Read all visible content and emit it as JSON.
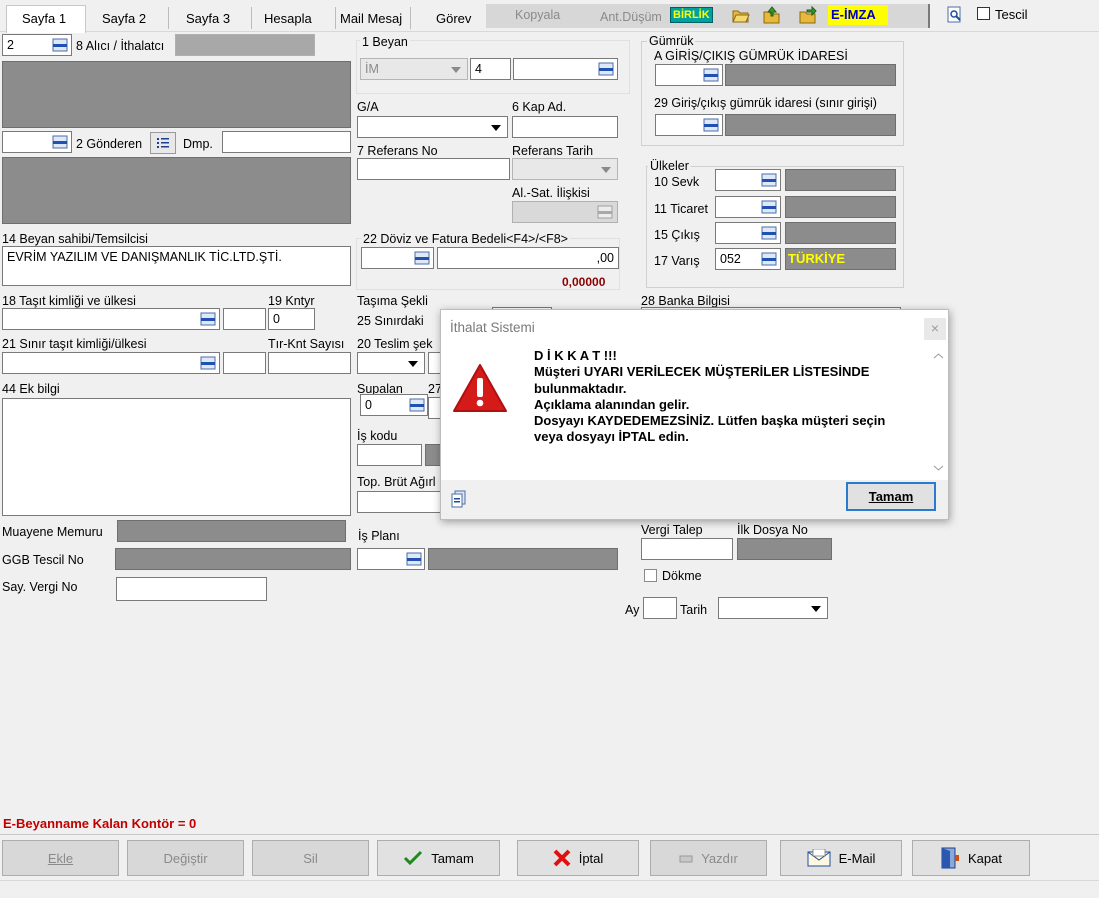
{
  "tabs": [
    "Sayfa 1",
    "Sayfa 2",
    "Sayfa 3",
    "Hesapla",
    "Mail Mesaj",
    "Görev"
  ],
  "toolbar": {
    "kopyala": "Kopyala",
    "ant_dusum": "Ant.Düşüm",
    "birlik": "BİRLİK",
    "eimza": "E-İMZA",
    "tescil": "Tescil"
  },
  "left": {
    "alici_value": "2",
    "alici_label": "8 Alıcı / İthalatcı",
    "gonderen_label": "2 Gönderen",
    "dmp_label": "Dmp.",
    "beyan_sahibi_label": "14 Beyan sahibi/Temsilcisi",
    "beyan_sahibi_value": "EVRİM YAZILIM VE DANIŞMANLIK TİC.LTD.ŞTİ.",
    "tasit_label": "18 Taşıt kimliği ve ülkesi",
    "kntyr_label": "19 Kntyr",
    "kntyr_value": "0",
    "sinir_tasit_label": "21 Sınır taşıt kimliği/ülkesi",
    "tir_label": "Tır-Knt Sayısı",
    "ek_bilgi_label": "44 Ek bilgi",
    "muayene_label": "Muayene Memuru",
    "ggb_label": "GGB Tescil No",
    "say_vergi_label": "Say. Vergi No"
  },
  "middle": {
    "beyan_label": "1 Beyan",
    "beyan_type": "İM",
    "beyan_num": "4",
    "ga_label": "G/A",
    "kap_label": "6 Kap Ad.",
    "referans_no_label": "7 Referans No",
    "referans_tarih_label": "Referans Tarih",
    "al_sat_label": "Al.-Sat. İlişkisi",
    "doviz_label": "22 Döviz ve Fatura Bedeli<F4>/<F8>",
    "doviz_value": ",00",
    "doviz_total": "0,00000",
    "tasima_label": "Taşıma Şekli",
    "sinirdaki_label": "25 Sınırdaki",
    "teslim_label": "20 Teslim şek",
    "supalan_label": "Supalan",
    "supalan_value": "0",
    "label_27": "27",
    "is_kodu_label": "İş kodu",
    "top_brut_label": "Top. Brüt Ağırl",
    "is_plani_label": "İş Planı"
  },
  "right": {
    "gumruk_label": "Gümrük",
    "giris_label": "A GİRİŞ/ÇIKIŞ GÜMRÜK İDARESİ",
    "sinir_giris_label": "29 Giriş/çıkış gümrük idaresi (sınır girişi)",
    "ulkeler_label": "Ülkeler",
    "sevk_label": "10 Sevk",
    "ticaret_label": "11 Ticaret",
    "cikis_label": "15 Çıkış",
    "varis_label": "17 Varış",
    "varis_code": "052",
    "varis_country": "TÜRKİYE",
    "banka_label": "28 Banka Bilgisi",
    "vergi_talep_label": "Vergi Talep",
    "ilk_dosya_label": "İlk Dosya No",
    "dokme_label": "Dökme",
    "ay_label": "Ay",
    "tarih_label": "Tarih"
  },
  "status": {
    "kontor": "E-Beyanname Kalan Kontör = 0"
  },
  "buttons": {
    "ekle": "Ekle",
    "degistir": "Değiştir",
    "sil": "Sil",
    "tamam": "Tamam",
    "iptal": "İptal",
    "yazdir": "Yazdır",
    "email": "E-Mail",
    "kapat": "Kapat"
  },
  "dialog": {
    "title": "İthalat Sistemi",
    "close": "×",
    "lines": [
      "D İ K K A T !!!",
      "Müşteri UYARI VERİLECEK MÜŞTERİLER LİSTESİNDE",
      "bulunmaktadır.",
      "Açıklama alanından gelir.",
      "Dosyayı KAYDEDEMEZSİNİZ. Lütfen başka müşteri seçin",
      "veya dosyayı İPTAL edin."
    ],
    "ok": "Tamam"
  },
  "colors": {
    "accent_red": "#c00000",
    "varis_yellow": "#ffff00",
    "eimza_bg": "#ffff00",
    "birlik_bg": "#00a0a0",
    "gray_field": "#8c8c8c"
  }
}
